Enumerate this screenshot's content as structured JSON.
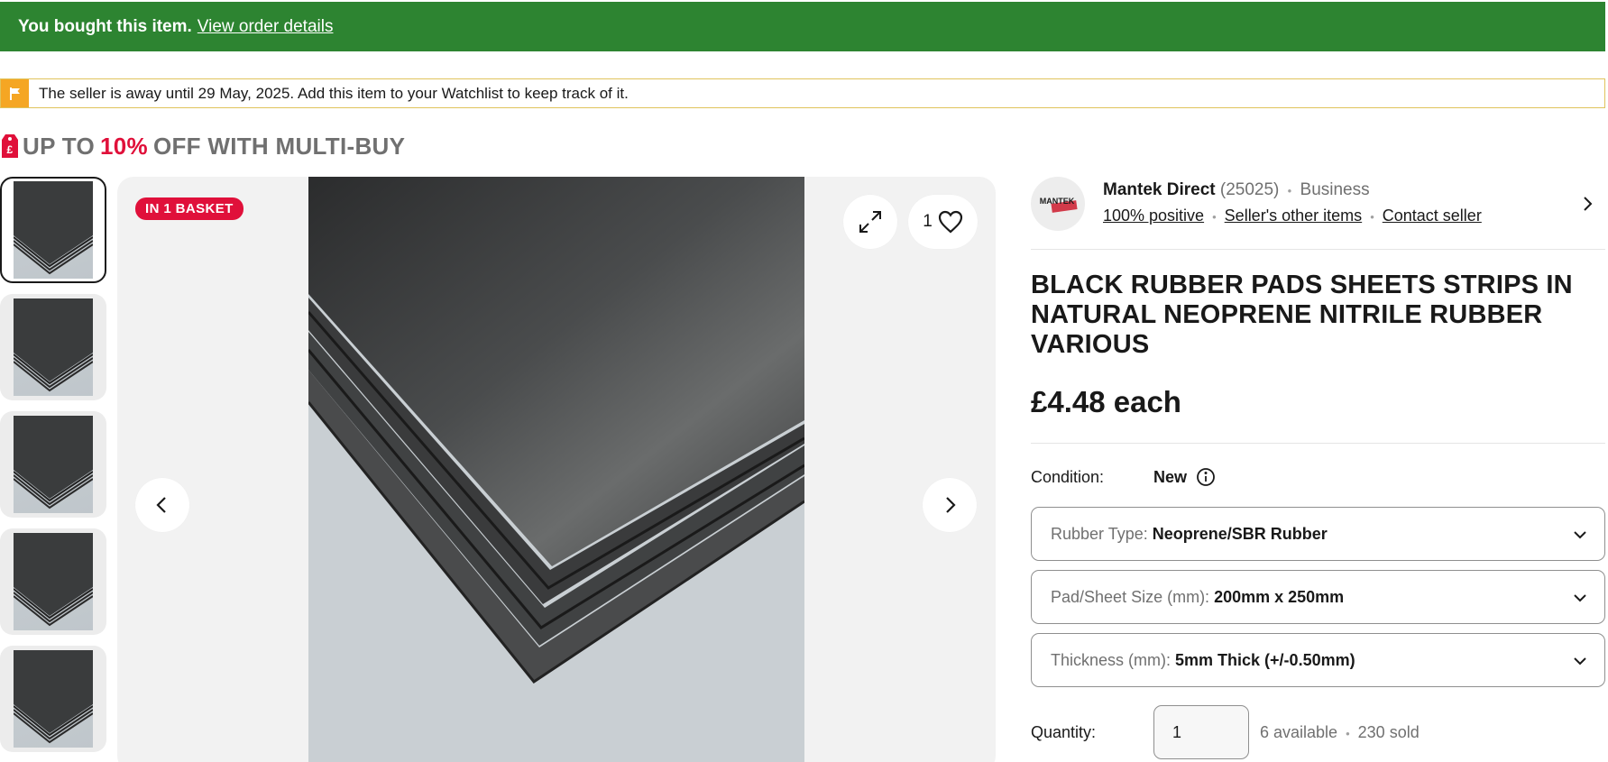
{
  "banner": {
    "message": "You bought this item.",
    "link": "View order details",
    "color": "#2d8431"
  },
  "notice": {
    "text": "The seller is away until 29 May, 2025. Add this item to your Watchlist to keep track of it.",
    "icon": "flag-icon"
  },
  "promo": {
    "prefix": "UP TO",
    "percent": "10%",
    "suffix": "OFF WITH MULTI-BUY",
    "icon": "price-tag-icon",
    "accent": "#e0103a"
  },
  "gallery": {
    "badge": "IN 1 BASKET",
    "watch_count": "1",
    "thumbnail_count": 5,
    "selected_index": 0
  },
  "seller": {
    "logo_text": "MANTEK",
    "name": "Mantek Direct",
    "feedback_count": "(25025)",
    "type": "Business",
    "positive": "100% positive",
    "other_items": "Seller's other items",
    "contact": "Contact seller"
  },
  "listing": {
    "title": "BLACK RUBBER PADS SHEETS STRIPS IN NATURAL NEOPRENE NITRILE RUBBER VARIOUS",
    "price": "£4.48 each",
    "condition_label": "Condition:",
    "condition_value": "New"
  },
  "variants": [
    {
      "label": "Rubber Type:",
      "value": "Neoprene/SBR Rubber"
    },
    {
      "label": "Pad/Sheet Size (mm):",
      "value": "200mm x 250mm"
    },
    {
      "label": "Thickness (mm):",
      "value": "5mm Thick (+/-0.50mm)"
    }
  ],
  "quantity": {
    "label": "Quantity:",
    "value": "1",
    "available": "6 available",
    "sold": "230 sold"
  }
}
